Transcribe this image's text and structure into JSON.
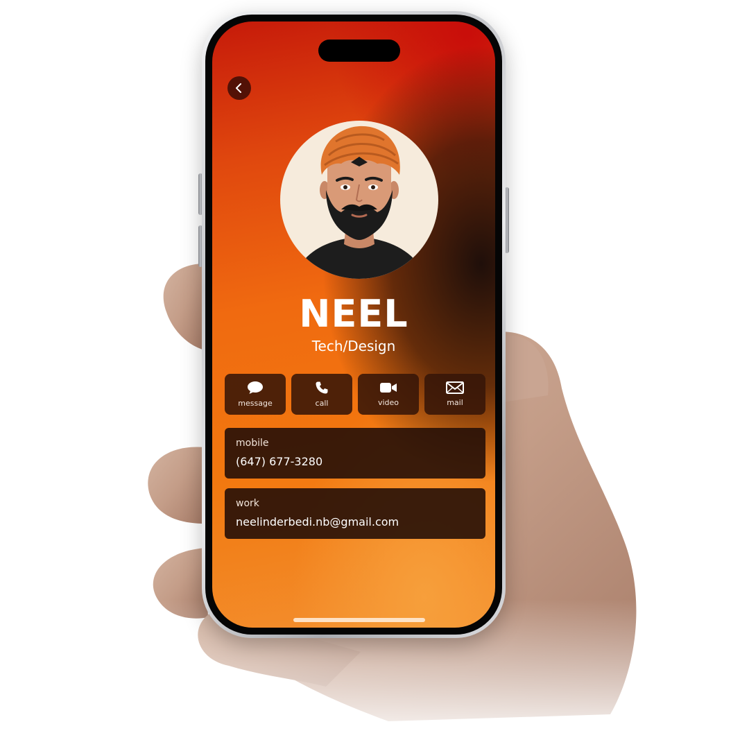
{
  "contact": {
    "name": "NEEL",
    "subtitle": "Tech/Design"
  },
  "actions": [
    {
      "label": "message",
      "icon": "message-icon"
    },
    {
      "label": "call",
      "icon": "phone-icon"
    },
    {
      "label": "video",
      "icon": "video-icon"
    },
    {
      "label": "mail",
      "icon": "mail-icon"
    }
  ],
  "fields": [
    {
      "label": "mobile",
      "value": "(647) 677-3280"
    },
    {
      "label": "work",
      "value": "neelinderbedi.nb@gmail.com"
    }
  ],
  "icons": {
    "back": "chevron-left-icon"
  },
  "colors": {
    "background_top": "#c61a0a",
    "background_mid": "#f06a10",
    "card_bg": "#26100a",
    "text": "#ffffff"
  }
}
